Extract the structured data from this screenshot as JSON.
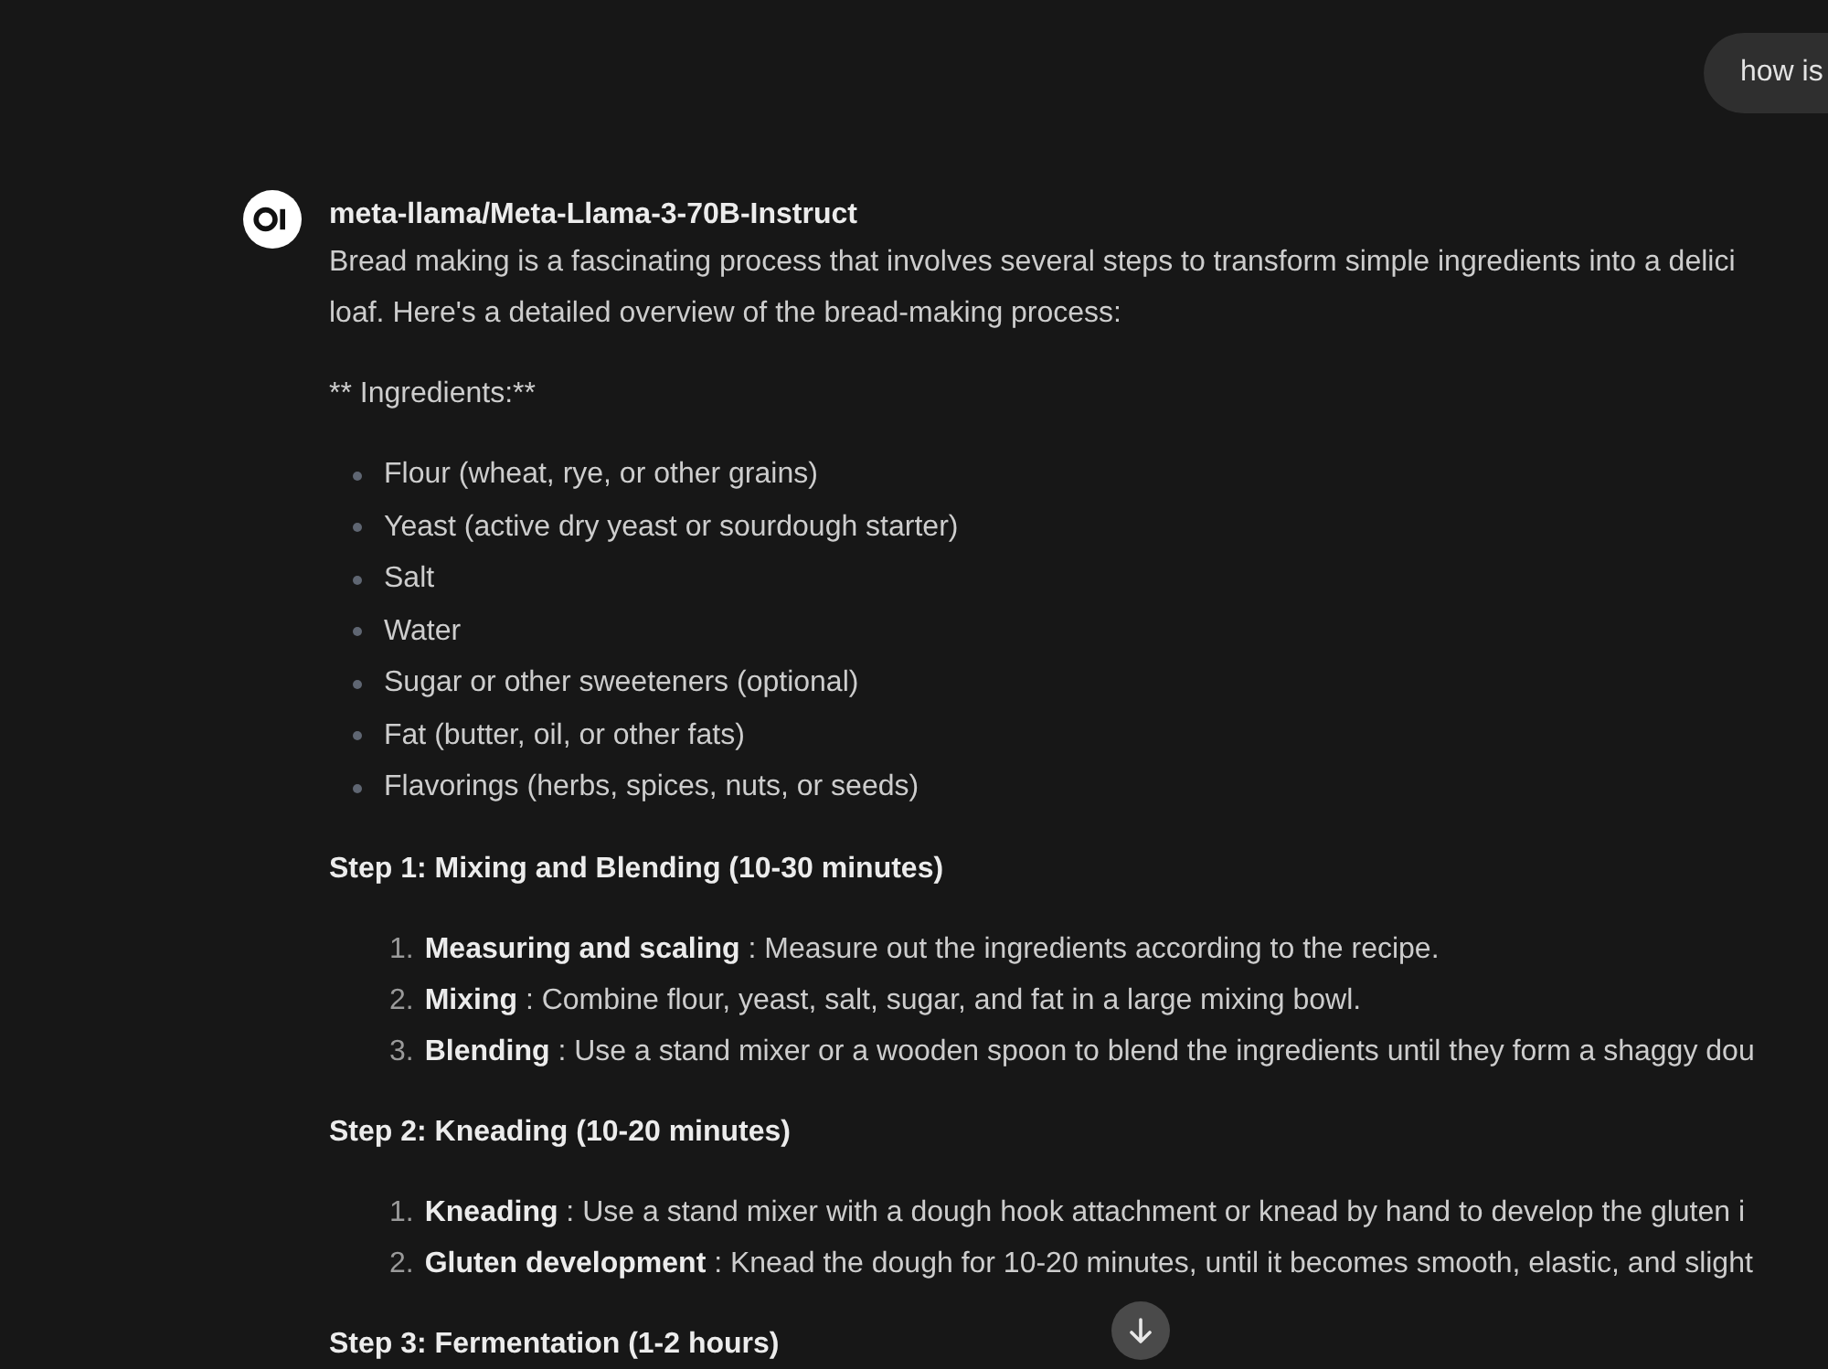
{
  "user_message": {
    "text": "how is"
  },
  "reply": {
    "model": "meta-llama/Meta-Llama-3-70B-Instruct",
    "intro": [
      "Bread making is a fascinating process that involves several steps to transform simple ingredients into a delici",
      "loaf. Here's a detailed overview of the bread-making process:"
    ],
    "ingredients_label": "** Ingredients:**",
    "ingredients": [
      "Flour (wheat, rye, or other grains)",
      "Yeast (active dry yeast or sourdough starter)",
      "Salt",
      "Water",
      "Sugar or other sweeteners (optional)",
      "Fat (butter, oil, or other fats)",
      "Flavorings (herbs, spices, nuts, or seeds)"
    ],
    "sections": [
      {
        "heading": "Step 1: Mixing and Blending (10-30 minutes)",
        "items": [
          {
            "number": "1.",
            "text": "**Measuring and scaling** : Measure out the ingredients according to the recipe."
          },
          {
            "number": "2.",
            "text": "**Mixing** : Combine flour, yeast, salt, sugar, and fat in a large mixing bowl."
          },
          {
            "number": "3.",
            "text": "**Blending** : Use a stand mixer or a wooden spoon to blend the ingredients until they form a shaggy dou"
          }
        ]
      },
      {
        "heading": "Step 2: Kneading (10-20 minutes)",
        "items": [
          {
            "number": "1.",
            "text": "**Kneading** : Use a stand mixer with a dough hook attachment or knead by hand to develop the gluten i"
          },
          {
            "number": "2.",
            "text": "**Gluten development** : Knead the dough for 10-20 minutes, until it becomes smooth, elastic, and slight"
          }
        ]
      },
      {
        "heading": "Step 3: Fermentation (1-2 hours)"
      }
    ]
  }
}
